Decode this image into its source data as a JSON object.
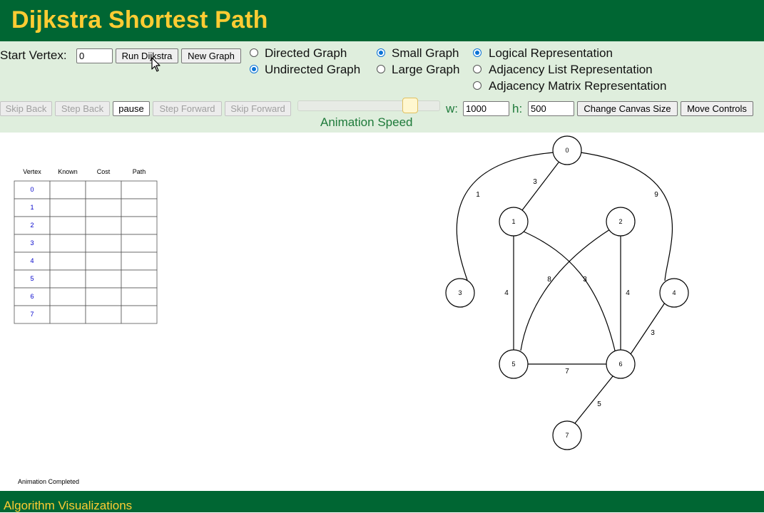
{
  "header": {
    "title": "Dijkstra Shortest Path"
  },
  "controls": {
    "start_vertex_label": "Start Vertex:",
    "start_vertex_value": "0",
    "run_button": "Run Dijkstra",
    "new_graph_button": "New Graph",
    "directed_option": "Directed Graph",
    "undirected_option": "Undirected Graph",
    "small_option": "Small Graph",
    "large_option": "Large Graph",
    "logical_option": "Logical Representation",
    "adj_list_option": "Adjacency List Representation",
    "adj_matrix_option": "Adjacency Matrix Representation",
    "skip_back": "Skip Back",
    "step_back": "Step Back",
    "pause": "pause",
    "step_forward": "Step Forward",
    "skip_forward": "Skip Forward",
    "animation_speed_label": "Animation Speed",
    "animation_speed_value": 0.8,
    "w_label": "w:",
    "w_value": "1000",
    "h_label": "h:",
    "h_value": "500",
    "change_canvas_button": "Change Canvas Size",
    "move_controls_button": "Move Controls"
  },
  "selected": {
    "graph_direction": "undirected",
    "graph_size": "small",
    "representation": "logical"
  },
  "table": {
    "headers": [
      "Vertex",
      "Known",
      "Cost",
      "Path"
    ],
    "rows": [
      {
        "vertex": "0",
        "known": "",
        "cost": "",
        "path": ""
      },
      {
        "vertex": "1",
        "known": "",
        "cost": "",
        "path": ""
      },
      {
        "vertex": "2",
        "known": "",
        "cost": "",
        "path": ""
      },
      {
        "vertex": "3",
        "known": "",
        "cost": "",
        "path": ""
      },
      {
        "vertex": "4",
        "known": "",
        "cost": "",
        "path": ""
      },
      {
        "vertex": "5",
        "known": "",
        "cost": "",
        "path": ""
      },
      {
        "vertex": "6",
        "known": "",
        "cost": "",
        "path": ""
      },
      {
        "vertex": "7",
        "known": "",
        "cost": "",
        "path": ""
      }
    ]
  },
  "graph": {
    "vertices": [
      "0",
      "1",
      "2",
      "3",
      "4",
      "5",
      "6",
      "7"
    ],
    "edges": [
      {
        "from": "0",
        "to": "1",
        "weight": "3"
      },
      {
        "from": "0",
        "to": "3",
        "weight": "1"
      },
      {
        "from": "0",
        "to": "4",
        "weight": "9"
      },
      {
        "from": "1",
        "to": "5",
        "weight": "4"
      },
      {
        "from": "1",
        "to": "6",
        "weight": "3"
      },
      {
        "from": "2",
        "to": "5",
        "weight": "8"
      },
      {
        "from": "2",
        "to": "6",
        "weight": "4"
      },
      {
        "from": "4",
        "to": "6",
        "weight": "3"
      },
      {
        "from": "5",
        "to": "6",
        "weight": "7"
      },
      {
        "from": "6",
        "to": "7",
        "weight": "5"
      }
    ]
  },
  "status": {
    "message": "Animation Completed"
  },
  "footer": {
    "text": "Algorithm Visualizations"
  },
  "colors": {
    "header_bg": "#006633",
    "header_text": "#ffcc33",
    "controls_bg": "#dfeedd",
    "vertex_label": "#0000cc",
    "speed_label": "#1e7a3a"
  }
}
